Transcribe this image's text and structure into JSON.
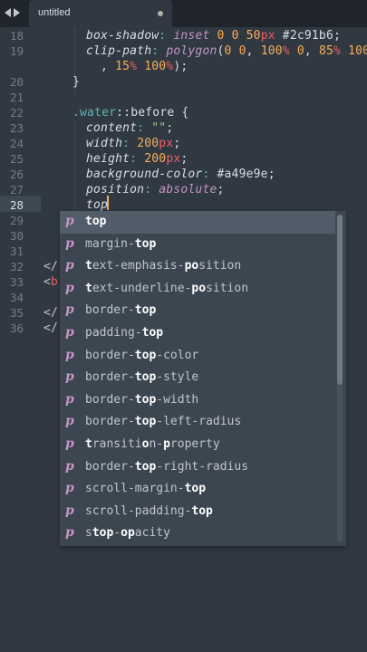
{
  "tab": {
    "title": "untitled"
  },
  "gutter": [
    "18",
    "19",
    "",
    "20",
    "21",
    "22",
    "23",
    "24",
    "25",
    "26",
    "27",
    "28",
    "29",
    "30",
    "31",
    "32",
    "33",
    "34",
    "35",
    "36"
  ],
  "code": {
    "l18": {
      "prop": "box-shadow",
      "v1": "inset",
      "n1": "0",
      "n2": "0",
      "n3": "50",
      "u3": "px",
      "hex": "#2c91b6"
    },
    "l19": {
      "prop": "clip-path",
      "fn": "polygon",
      "text1": "0 0, ",
      "a": "100",
      "p": "%",
      "text2": " 0, ",
      "b": "85",
      "c": "100"
    },
    "l19b": {
      "a": "15",
      "b": "100"
    },
    "l22": {
      "sel": ".water",
      "pseudo": "::before",
      "brace": "{"
    },
    "l23": {
      "prop": "content",
      "val": "\"\""
    },
    "l24": {
      "prop": "width",
      "num": "200",
      "unit": "px"
    },
    "l25": {
      "prop": "height",
      "num": "200",
      "unit": "px"
    },
    "l26": {
      "prop": "background-color",
      "hex": "#a49e9e"
    },
    "l27": {
      "prop": "position",
      "val": "absolute"
    },
    "l28": {
      "typed": "top"
    },
    "l32_frag": "</",
    "l33_frag": "<",
    "l33_tag": "b",
    "l35_frag": "</",
    "l36_frag": "</"
  },
  "autocomplete": {
    "items": [
      {
        "kind": "p",
        "pre": "",
        "match": "top",
        "post": ""
      },
      {
        "kind": "p",
        "pre": "margin-",
        "match": "top",
        "post": ""
      },
      {
        "kind": "p",
        "pre": "",
        "match": "t",
        "post": "ext-emphasis-",
        "match2": "po",
        "post2": "sition"
      },
      {
        "kind": "p",
        "pre": "",
        "match": "t",
        "post": "ext-underline-",
        "match2": "po",
        "post2": "sition"
      },
      {
        "kind": "p",
        "pre": "border-",
        "match": "top",
        "post": ""
      },
      {
        "kind": "p",
        "pre": "padding-",
        "match": "top",
        "post": ""
      },
      {
        "kind": "p",
        "pre": "border-",
        "match": "top",
        "post": "-color"
      },
      {
        "kind": "p",
        "pre": "border-",
        "match": "top",
        "post": "-style"
      },
      {
        "kind": "p",
        "pre": "border-",
        "match": "top",
        "post": "-width"
      },
      {
        "kind": "p",
        "pre": "border-",
        "match": "top",
        "post": "-left-radius"
      },
      {
        "kind": "p",
        "pre": "",
        "match": "t",
        "post": "ransiti",
        "match2": "o",
        "post2": "n-",
        "match3": "p",
        "post3": "roperty"
      },
      {
        "kind": "p",
        "pre": "border-",
        "match": "top",
        "post": "-right-radius"
      },
      {
        "kind": "p",
        "pre": "scroll-margin-",
        "match": "top",
        "post": ""
      },
      {
        "kind": "p",
        "pre": "scroll-padding-",
        "match": "top",
        "post": ""
      },
      {
        "kind": "p",
        "pre": "s",
        "match": "top",
        "post": "-",
        "match2": "op",
        "post2": "acity"
      }
    ]
  }
}
